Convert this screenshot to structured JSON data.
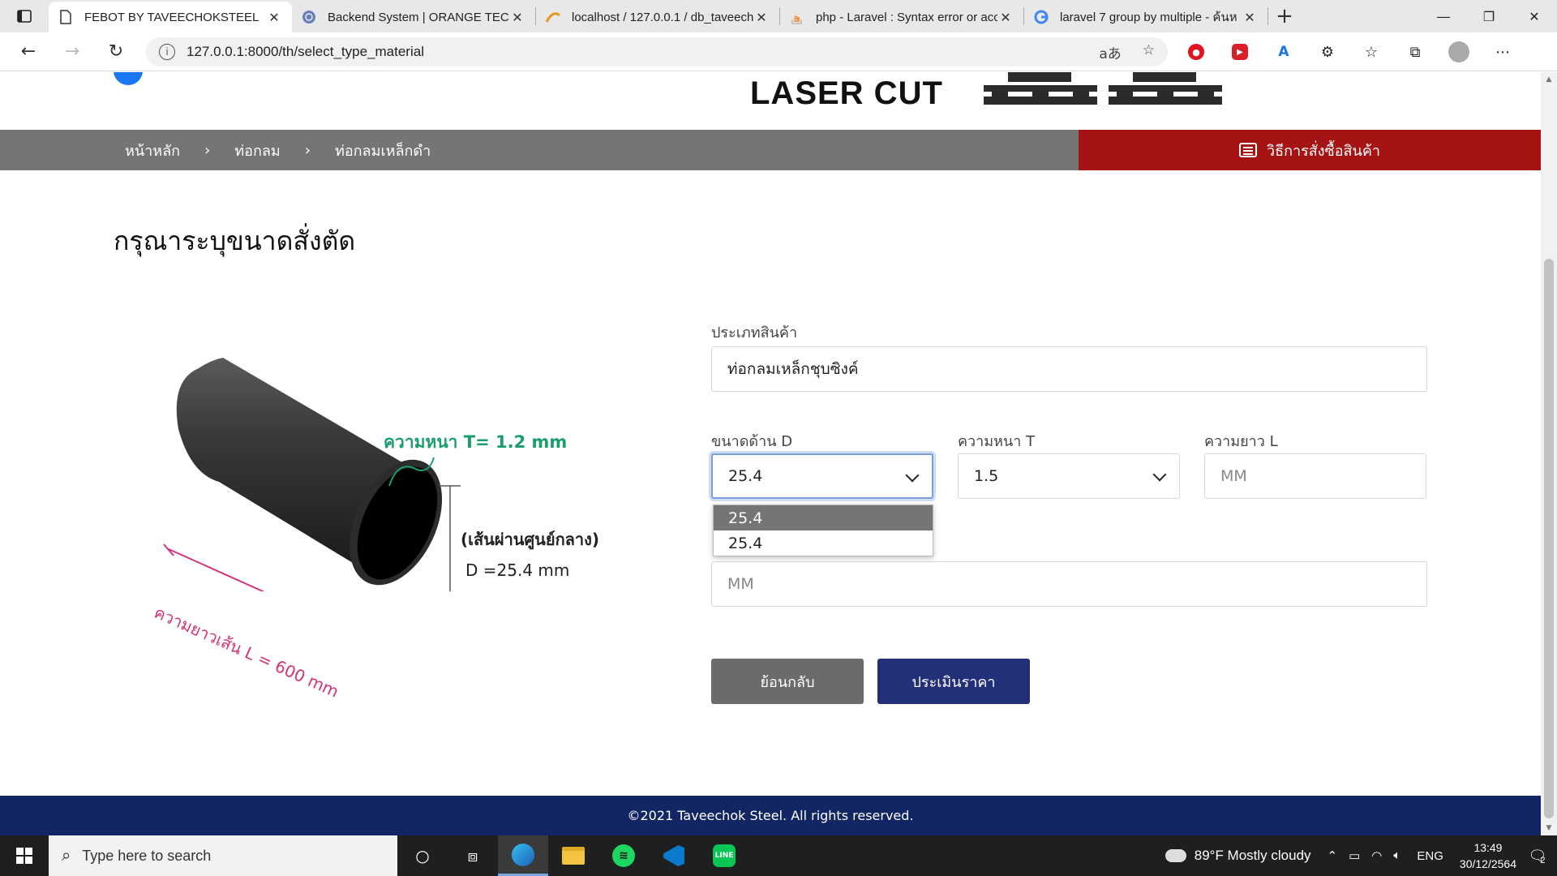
{
  "browser": {
    "tabs": [
      {
        "title": "FEBOT BY TAVEECHOKSTEEL",
        "icon": "page-icon",
        "active": true
      },
      {
        "title": "Backend System | ORANGE TECH",
        "icon": "globe-icon",
        "active": false
      },
      {
        "title": "localhost / 127.0.0.1 / db_taveech",
        "icon": "phpmyadmin-icon",
        "active": false
      },
      {
        "title": "php - Laravel : Syntax error or acc",
        "icon": "stackoverflow-icon",
        "active": false
      },
      {
        "title": "laravel 7 group by multiple - ค้นห",
        "icon": "google-icon",
        "active": false
      }
    ],
    "url": "127.0.0.1:8000/th/select_type_material",
    "read_aloud_label": "aあ"
  },
  "header": {
    "logo_text": "LASER CUT"
  },
  "breadcrumb": [
    "หน้าหลัก",
    "ท่อกลม",
    "ท่อกลมเหล็กดำ"
  ],
  "order_guide_label": "วิธีการสั่งซื้อสินค้า",
  "page_title": "กรุณาระบุขนาดสั่งตัด",
  "illustration": {
    "thickness_label": "ความหนา T= 1.2 mm",
    "diameter_label": "(เส้นผ่านศูนย์กลาง)",
    "diameter_value": "D =25.4 mm",
    "length_label": "ความยาวเส้น L = 600 mm"
  },
  "form": {
    "product_type_label": "ประเภทสินค้า",
    "product_type_value": "ท่อกลมเหล็กชุบซิงค์",
    "size_label": "ขนาดด้าน D",
    "size_value": "25.4",
    "size_options": [
      "25.4",
      "25.4"
    ],
    "thickness_label": "ความหนา T",
    "thickness_value": "1.5",
    "length_label": "ความยาว L",
    "length_placeholder": "MM",
    "quantity_placeholder": "MM",
    "back_button": "ย้อนกลับ",
    "estimate_button": "ประเมินราคา"
  },
  "footer_text": "©2021 Taveechok Steel. All rights reserved.",
  "taskbar": {
    "search_placeholder": "Type here to search",
    "weather": "89°F  Mostly cloudy",
    "language": "ENG",
    "time": "13:49",
    "date": "30/12/2564",
    "notification_count": "2"
  },
  "colors": {
    "breadcrumb_bg": "#757575",
    "order_guide_bg": "#a51313",
    "estimate_button_bg": "#22307a",
    "back_button_bg": "#6b6b6b",
    "footer_bg": "#132664",
    "illustration_green": "#1a9e6b",
    "illustration_pink": "#d4347a"
  }
}
